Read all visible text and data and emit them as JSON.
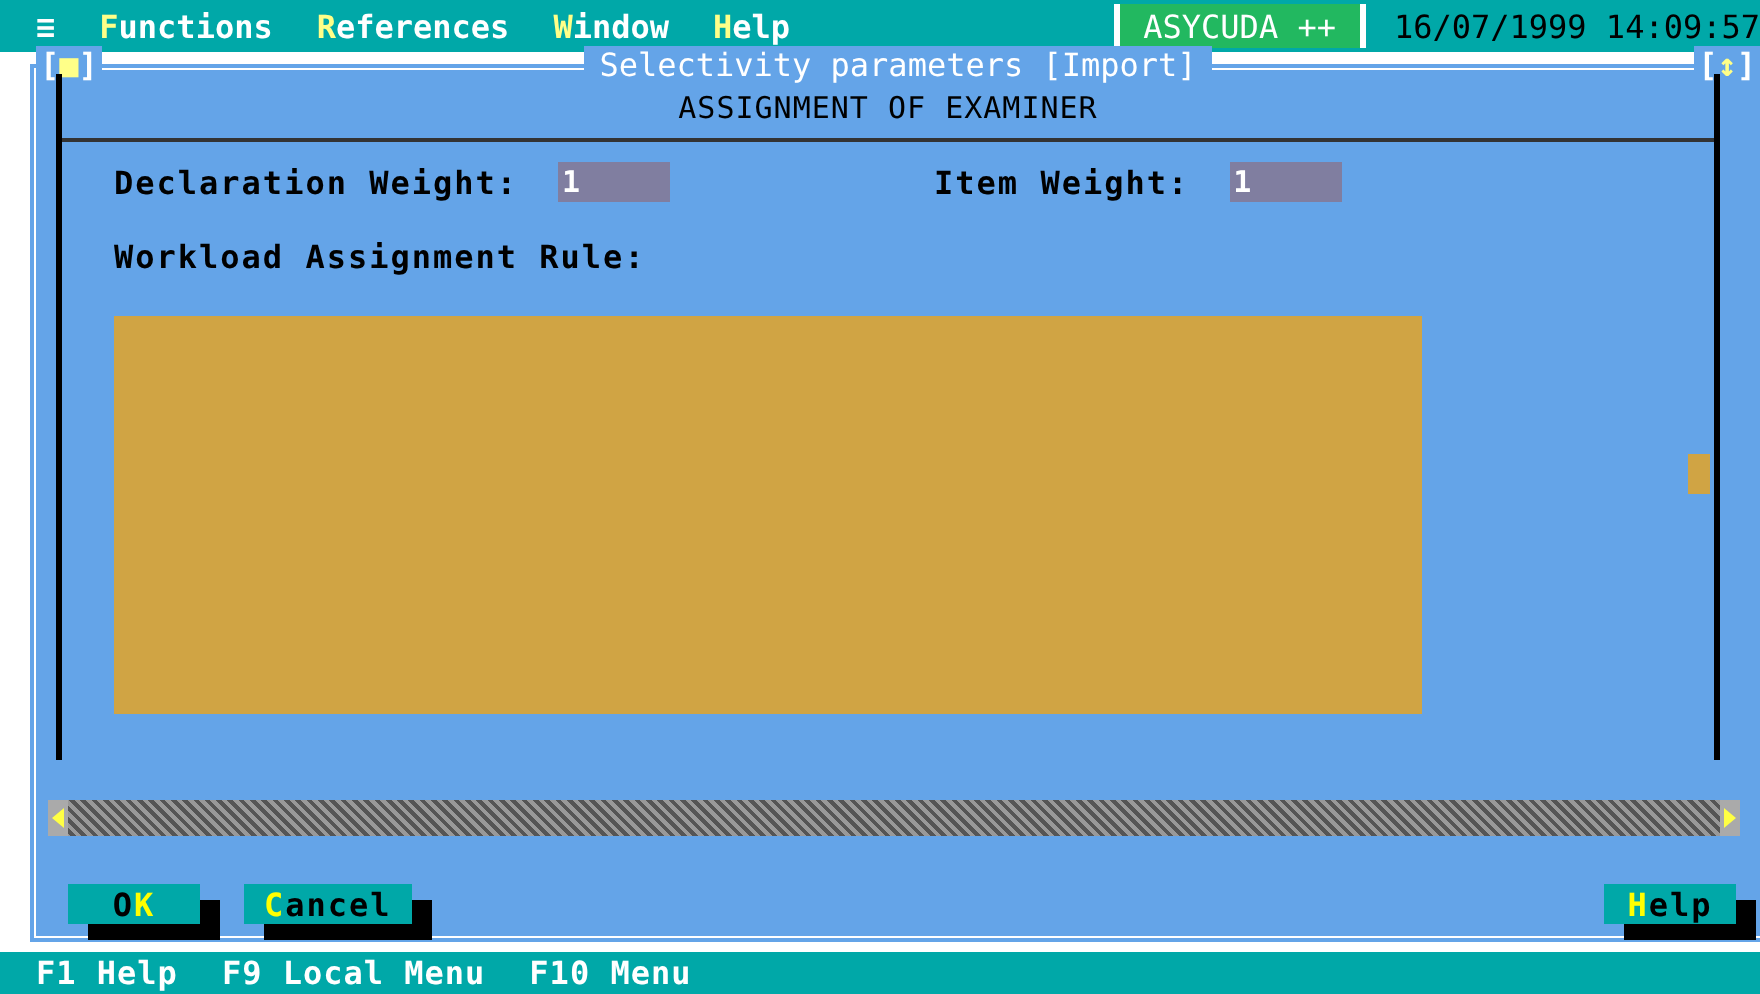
{
  "menu_bar": {
    "system_icon": "≡",
    "items": [
      {
        "key": "F",
        "rest": "unctions"
      },
      {
        "key": "R",
        "rest": "eferences"
      },
      {
        "key": "W",
        "rest": "indow"
      },
      {
        "key": "H",
        "rest": "elp"
      }
    ],
    "app_name": "ASYCUDA ++",
    "datetime": "16/07/1999 14:09:57"
  },
  "window": {
    "title": "Selectivity parameters [Import]",
    "close_control": {
      "open": "[",
      "glyph": "■",
      "close": "]"
    },
    "resize_control": {
      "open": "[",
      "glyph": "↕",
      "close": "]"
    },
    "heading": "ASSIGNMENT OF EXAMINER",
    "fields": [
      {
        "label": "Declaration Weight:",
        "value": "1"
      },
      {
        "label": "Item Weight:",
        "value": "1"
      }
    ],
    "rule_label": "Workload Assignment Rule:",
    "buttons": [
      {
        "before": "O",
        "key": "K"
      },
      {
        "key": "C",
        "after": "ancel"
      },
      {
        "key": "H",
        "after": "elp"
      }
    ]
  },
  "status_bar": [
    "F1 Help",
    "F9 Local Menu",
    "F10 Menu"
  ]
}
